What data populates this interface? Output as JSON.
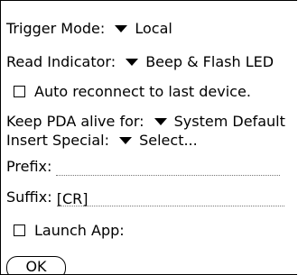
{
  "form": {
    "trigger_mode": {
      "label": "Trigger Mode:",
      "value": "Local"
    },
    "read_indicator": {
      "label": "Read Indicator:",
      "value": "Beep & Flash LED"
    },
    "auto_reconnect": {
      "label": "Auto reconnect to last device.",
      "checked": false
    },
    "keep_alive": {
      "label": "Keep PDA alive for:",
      "value": "System Default"
    },
    "insert_special": {
      "label": "Insert Special:",
      "value": "Select..."
    },
    "prefix": {
      "label": "Prefix:",
      "value": ""
    },
    "suffix": {
      "label": "Suffix:",
      "value": "[CR]"
    },
    "launch_app": {
      "label": "Launch App:",
      "checked": false
    }
  },
  "buttons": {
    "ok_label": "OK"
  },
  "icons": {
    "dropdown": "dropdown-triangle-icon",
    "checkbox": "checkbox-icon"
  }
}
